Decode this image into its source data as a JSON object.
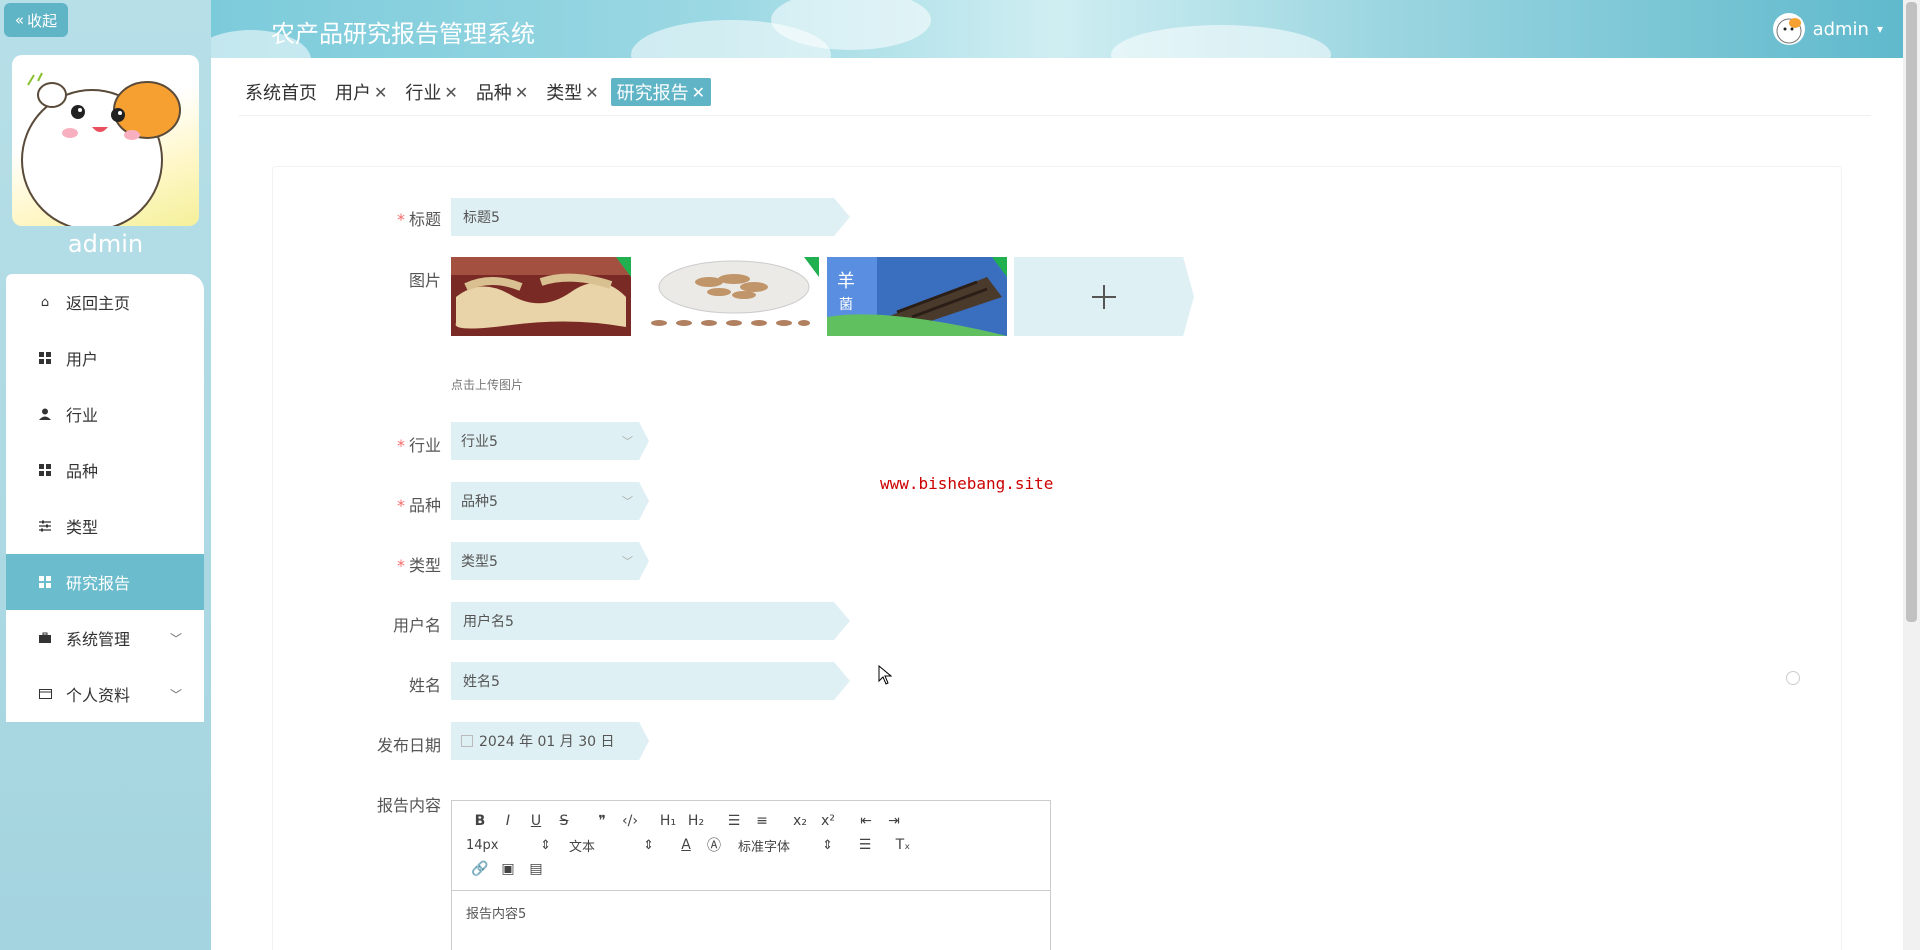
{
  "sidebar": {
    "collapse_label": "收起",
    "username": "admin",
    "menu": [
      {
        "label": "返回主页",
        "icon": "home-icon"
      },
      {
        "label": "用户",
        "icon": "grid-icon"
      },
      {
        "label": "行业",
        "icon": "user-icon"
      },
      {
        "label": "品种",
        "icon": "grid-icon"
      },
      {
        "label": "类型",
        "icon": "sliders-icon"
      },
      {
        "label": "研究报告",
        "icon": "grid-icon",
        "active": true
      },
      {
        "label": "系统管理",
        "icon": "briefcase-icon",
        "has_children": true
      },
      {
        "label": "个人资料",
        "icon": "card-icon",
        "has_children": true
      }
    ]
  },
  "header": {
    "title": "农产品研究报告管理系统",
    "user": "admin"
  },
  "tabs": [
    {
      "label": "系统首页",
      "closable": false
    },
    {
      "label": "用户",
      "closable": true
    },
    {
      "label": "行业",
      "closable": true
    },
    {
      "label": "品种",
      "closable": true
    },
    {
      "label": "类型",
      "closable": true
    },
    {
      "label": "研究报告",
      "closable": true,
      "active": true
    }
  ],
  "form": {
    "title": {
      "label": "标题",
      "required": true,
      "value": "标题5"
    },
    "images": {
      "label": "图片",
      "hint": "点击上传图片",
      "count": 3
    },
    "industry": {
      "label": "行业",
      "required": true,
      "value": "行业5"
    },
    "variety": {
      "label": "品种",
      "required": true,
      "value": "品种5"
    },
    "type": {
      "label": "类型",
      "required": true,
      "value": "类型5"
    },
    "username": {
      "label": "用户名",
      "value": "用户名5"
    },
    "name": {
      "label": "姓名",
      "value": "姓名5"
    },
    "publish_date": {
      "label": "发布日期",
      "value": "2024 年 01 月 30 日"
    },
    "content": {
      "label": "报告内容",
      "value": "报告内容5"
    }
  },
  "editor": {
    "font_size": "14px",
    "paragraph": "文本",
    "font_family": "标准字体"
  },
  "watermark": "www.bishebang.site",
  "colors": {
    "accent": "#5fb4c6",
    "input_bg": "#dff0f4",
    "required": "#f56c6c"
  }
}
